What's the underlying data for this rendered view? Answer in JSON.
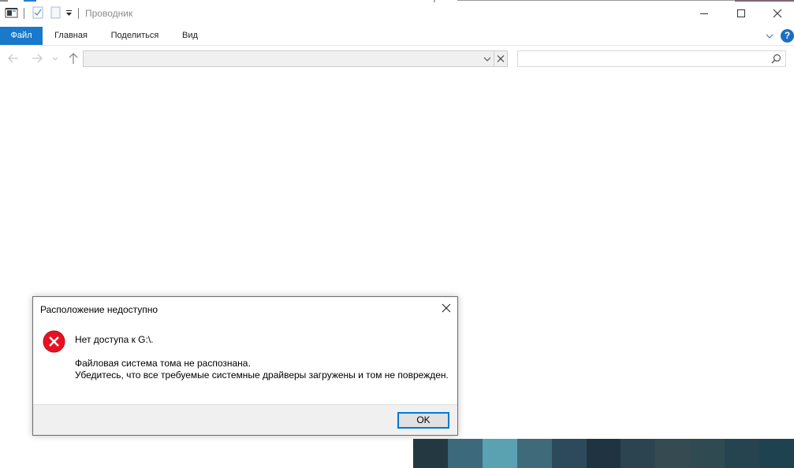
{
  "window": {
    "title": "Проводник",
    "icons": {
      "app": "explorer-icon",
      "properties": "properties-icon",
      "new_folder": "new-folder-icon",
      "customize": "customize-qat-icon",
      "minimize": "minimize-icon",
      "maximize": "maximize-icon",
      "close": "close-icon"
    }
  },
  "ribbon": {
    "tabs": [
      {
        "label": "Файл",
        "active": true
      },
      {
        "label": "Главная"
      },
      {
        "label": "Поделиться"
      },
      {
        "label": "Вид"
      }
    ],
    "help_label": "?",
    "accent": "#1979ca"
  },
  "navigation": {
    "address_value": "",
    "search_placeholder": "",
    "icons": [
      "back-arrow-icon",
      "forward-arrow-icon",
      "recent-locations-icon",
      "up-arrow-icon",
      "chevron-down-icon",
      "clear-icon",
      "search-icon"
    ]
  },
  "dialog": {
    "title": "Расположение недоступно",
    "main_text": "Нет доступа к G:\\.",
    "detail_line1": "Файловая система тома не распознана.",
    "detail_line2": "Убедитесь, что все требуемые системные драйверы загружены и том не поврежден.",
    "ok_label": "OK",
    "error_color": "#e81123"
  },
  "wallpaper_strip_colors": [
    "#233840",
    "#3c6a7c",
    "#5aa1b1",
    "#3e6a7a",
    "#2d4a5c",
    "#1f3340",
    "#2c4450",
    "#364a52",
    "#304a52",
    "#264450",
    "#1f4250"
  ]
}
